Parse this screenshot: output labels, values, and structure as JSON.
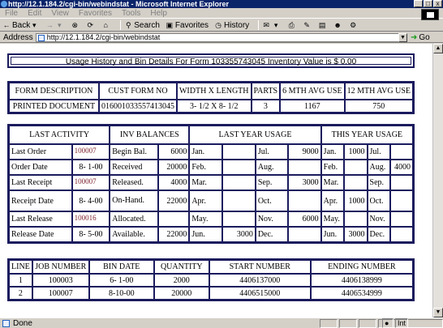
{
  "window": {
    "title": "http://12.1.184.2/cgi-bin/webindstat - Microsoft Internet Explorer",
    "min": "_",
    "max": "□",
    "close": "x"
  },
  "menu": [
    "File",
    "Edit",
    "View",
    "Favorites",
    "Tools",
    "Help"
  ],
  "toolbar": {
    "back": "Back",
    "search": "Search",
    "favorites": "Favorites",
    "history": "History"
  },
  "address": {
    "label": "Address",
    "url": "http://12.1.184.2/cgi-bin/webindstat",
    "go": "Go"
  },
  "banner": {
    "text": "Usage History and Bin Details For Form 103355743045 Inventory Value is $ 0.00"
  },
  "form_table": {
    "headers": [
      "FORM DESCRIPTION",
      "CUST FORM NO",
      "WIDTH X LENGTH",
      "PARTS",
      "6 MTH AVG USE",
      "12 MTH AVG USE"
    ],
    "row": [
      "PRINTED DOCUMENT",
      "016001033557413045",
      "3- 1/2 X 8- 1/2",
      "3",
      "1167",
      "750"
    ]
  },
  "activity": {
    "headers": [
      "LAST ACTIVITY",
      "INV BALANCES",
      "LAST YEAR USAGE",
      "THIS YEAR USAGE"
    ],
    "rows": [
      {
        "label": "Last Order",
        "value": "100007",
        "code": true,
        "inv_label": "Begin Bal.",
        "inv_value": "6000",
        "ly": [
          "Jan.",
          "",
          "Jul.",
          "9000"
        ],
        "ty": [
          "Jan.",
          "1000",
          "Jul.",
          ""
        ]
      },
      {
        "label": "Order Date",
        "value": "8- 1-00",
        "code": false,
        "inv_label": "Received",
        "inv_value": "20000",
        "ly": [
          "Feb.",
          "",
          "Aug.",
          ""
        ],
        "ty": [
          "Feb.",
          "",
          "Aug.",
          "4000"
        ]
      },
      {
        "label": "Last Receipt",
        "value": "100007",
        "code": true,
        "inv_label": "Released.",
        "inv_value": "4000",
        "ly": [
          "Mar.",
          "",
          "Sep.",
          "3000"
        ],
        "ty": [
          "Mar.",
          "",
          "Sep.",
          ""
        ]
      },
      {
        "label": "Receipt Date",
        "value": "8- 4-00",
        "code": false,
        "inv_label": "On-Hand.",
        "inv_value": "22000",
        "ly": [
          "Apr.",
          "",
          "Oct.",
          ""
        ],
        "ty": [
          "Apr.",
          "1000",
          "Oct.",
          ""
        ]
      },
      {
        "label": "Last Release",
        "value": "100016",
        "code": true,
        "inv_label": "Allocated.",
        "inv_value": "",
        "ly": [
          "May.",
          "",
          "Nov.",
          "6000"
        ],
        "ty": [
          "May.",
          "",
          "Nov.",
          ""
        ]
      },
      {
        "label": "Release Date",
        "value": "8- 5-00",
        "code": false,
        "inv_label": "Available.",
        "inv_value": "22000",
        "ly": [
          "Jun.",
          "3000",
          "Dec.",
          ""
        ],
        "ty": [
          "Jun.",
          "3000",
          "Dec.",
          ""
        ]
      }
    ]
  },
  "jobs": {
    "headers": [
      "LINE",
      "JOB NUMBER",
      "BIN DATE",
      "QUANTITY",
      "START NUMBER",
      "ENDING NUMBER"
    ],
    "rows": [
      [
        "1",
        "100003",
        "6- 1-00",
        "2000",
        "4406137000",
        "4406138999"
      ],
      [
        "2",
        "100007",
        "8-10-00",
        "20000",
        "4406515000",
        "4406534999"
      ]
    ]
  },
  "status": {
    "text": "Done",
    "zone": "Int"
  }
}
